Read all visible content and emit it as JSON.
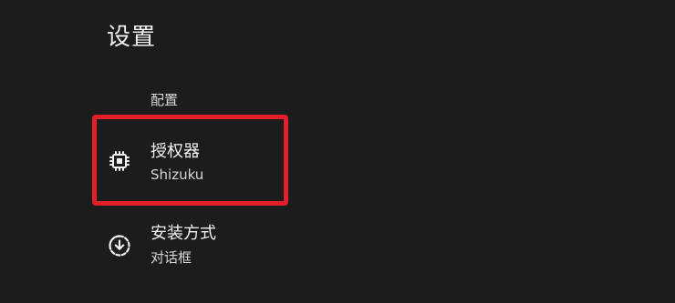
{
  "header": {
    "title": "设置"
  },
  "section": {
    "label": "配置"
  },
  "preferences": [
    {
      "icon": "chip-icon",
      "title": "授权器",
      "summary": "Shizuku"
    },
    {
      "icon": "download-circle-icon",
      "title": "安装方式",
      "summary": "对话框"
    }
  ],
  "annotation": {
    "highlight_color": "#e3202a"
  },
  "colors": {
    "background": "#1c1c1c",
    "text": "#eeeeee"
  }
}
